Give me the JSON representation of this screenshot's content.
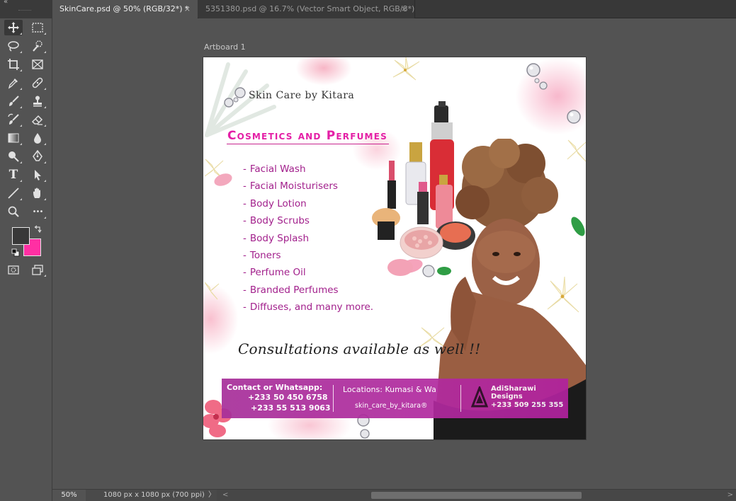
{
  "tabs": [
    {
      "label": "SkinCare.psd @ 50% (RGB/32*) *",
      "close": "×",
      "active": true
    },
    {
      "label": "5351380.psd @ 16.7% (Vector Smart Object, RGB/8*)",
      "close": "×",
      "active": false
    }
  ],
  "panel_collapse": "«",
  "toolbar": {
    "tools": [
      "move-tool",
      "marquee-tool",
      "lasso-tool",
      "quick-selection-tool",
      "crop-tool",
      "frame-tool",
      "eyedropper-tool",
      "spot-healing-tool",
      "brush-tool",
      "clone-stamp-tool",
      "history-brush-tool",
      "eraser-tool",
      "gradient-tool",
      "blur-tool",
      "dodge-tool",
      "pen-tool",
      "type-tool",
      "path-selection-tool",
      "line-tool",
      "hand-tool",
      "zoom-tool",
      "more-tools",
      "quick-mask-tool",
      "screen-mode-tool"
    ],
    "foreground_color": "#383838",
    "background_color": "#ff2fa3",
    "type_glyph": "T",
    "more_glyph": "•••"
  },
  "canvas": {
    "artboard_label": "Artboard 1",
    "brand": "Skin Care by Kitara",
    "heading": "Cosmetics and Perfumes",
    "services": [
      "Facial Wash",
      "Facial Moisturisers",
      "Body Lotion",
      "Body Scrubs",
      "Body Splash",
      "Toners",
      "Perfume Oil",
      "Branded Perfumes",
      "Diffuses, and many more."
    ],
    "service_bullet": "-",
    "consultation": "Consultations available as well !!",
    "contact_bar": {
      "contact_label": "Contact or Whatsapp:",
      "phone_1": "+233 50 450 6758",
      "phone_2": "+233 55 513 9063",
      "locations": "Locations: Kumasi & Wa",
      "handle": "skin_care_by_kitara®",
      "designer_line_1": "AdiSharawi",
      "designer_line_2": "Designs",
      "designer_phone": "+233 509 255 355"
    },
    "colors": {
      "accent": "#e41fa6",
      "list_text": "#a2208c",
      "bar": "#a72f9a"
    }
  },
  "status": {
    "zoom": "50%",
    "doc_info": "1080 px x 1080 px (700 ppi)",
    "expand_arrow": "〉",
    "scroll_left": "<",
    "scroll_right": ">"
  }
}
